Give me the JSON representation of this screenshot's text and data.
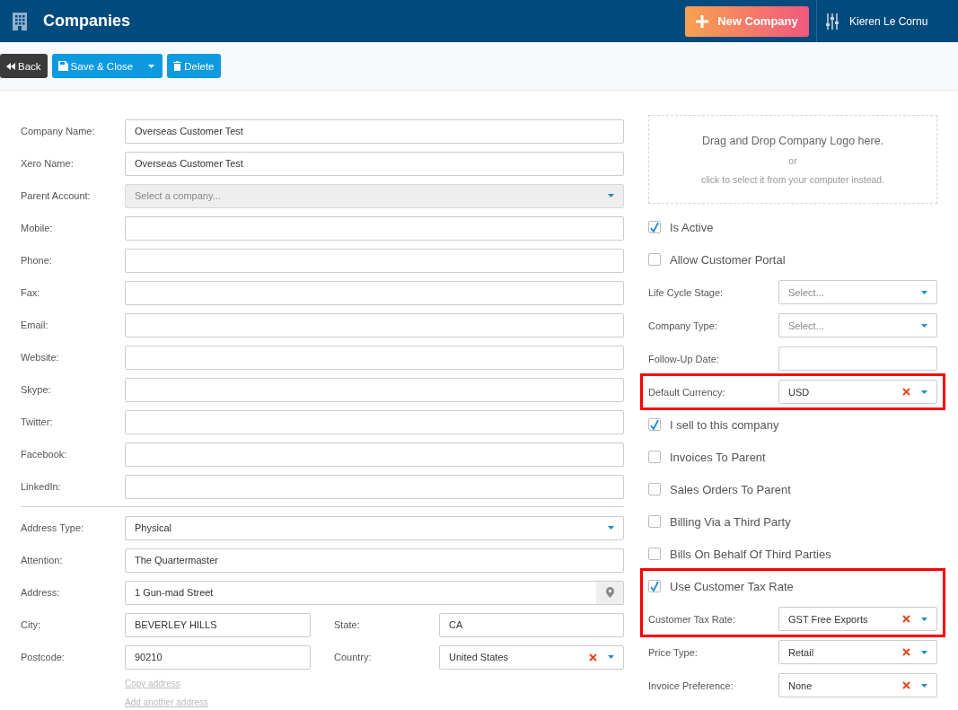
{
  "header": {
    "title": "Companies",
    "new_button": "New Company",
    "user": "Kieren Le Cornu"
  },
  "toolbar": {
    "back": "Back",
    "save": "Save & Close",
    "delete": "Delete"
  },
  "left_fields": [
    {
      "kind": "text",
      "label": "Company Name:",
      "value": "Overseas Customer Test"
    },
    {
      "kind": "text",
      "label": "Xero Name:",
      "value": "Overseas Customer Test"
    },
    {
      "kind": "select",
      "label": "Parent Account:",
      "placeholder": "Select a company...",
      "disabled": true,
      "clearable": false
    },
    {
      "kind": "text",
      "label": "Mobile:"
    },
    {
      "kind": "text",
      "label": "Phone:"
    },
    {
      "kind": "text",
      "label": "Fax:"
    },
    {
      "kind": "text",
      "label": "Email:"
    },
    {
      "kind": "text",
      "label": "Website:"
    },
    {
      "kind": "text",
      "label": "Skype:"
    },
    {
      "kind": "text",
      "label": "Twitter:"
    },
    {
      "kind": "text",
      "label": "Facebook:"
    },
    {
      "kind": "text",
      "label": "LinkedIn:"
    }
  ],
  "address_fields": [
    {
      "kind": "select",
      "label": "Address Type:",
      "value": "Physical",
      "disabled": false,
      "clearable": false
    },
    {
      "kind": "text",
      "label": "Attention:",
      "value": "The Quartermaster"
    },
    {
      "kind": "address",
      "label": "Address:",
      "value": "1 Gun-mad Street"
    }
  ],
  "address_pairs": [
    [
      {
        "kind": "text",
        "label": "City:",
        "value": "BEVERLEY HILLS"
      },
      {
        "kind": "text",
        "label": "State:",
        "value": "CA"
      }
    ],
    [
      {
        "kind": "text",
        "label": "Postcode:",
        "value": "90210"
      },
      {
        "kind": "select",
        "label": "Country:",
        "value": "United States",
        "disabled": false,
        "clearable": true
      }
    ]
  ],
  "address_links": [
    "Copy address",
    "Add another address"
  ],
  "dropzone": {
    "title": "Drag and Drop Company Logo here.",
    "or": "or",
    "hint": "click to select it from your computer instead."
  },
  "right_groups": [
    {
      "highlighted": false,
      "items": [
        {
          "kind": "checkbox",
          "label": "Is Active",
          "checked": true
        },
        {
          "kind": "checkbox",
          "label": "Allow Customer Portal",
          "checked": false
        },
        {
          "kind": "select",
          "label": "Life Cycle Stage:",
          "placeholder": "Select...",
          "clearable": false
        },
        {
          "kind": "select",
          "label": "Company Type:",
          "placeholder": "Select...",
          "clearable": false
        },
        {
          "kind": "date",
          "label": "Follow-Up Date:"
        }
      ]
    },
    {
      "highlighted": true,
      "items": [
        {
          "kind": "select",
          "label": "Default Currency:",
          "value": "USD",
          "clearable": true
        }
      ]
    },
    {
      "highlighted": false,
      "items": [
        {
          "kind": "checkbox",
          "label": "I sell to this company",
          "checked": true
        },
        {
          "kind": "checkbox",
          "label": "Invoices To Parent",
          "checked": false
        },
        {
          "kind": "checkbox",
          "label": "Sales Orders To Parent",
          "checked": false
        },
        {
          "kind": "checkbox",
          "label": "Billing Via a Third Party",
          "checked": false
        },
        {
          "kind": "checkbox",
          "label": "Bills On Behalf Of Third Parties",
          "checked": false
        }
      ]
    },
    {
      "highlighted": true,
      "items": [
        {
          "kind": "checkbox",
          "label": "Use Customer Tax Rate",
          "checked": true
        },
        {
          "kind": "select",
          "label": "Customer Tax Rate:",
          "value": "GST Free Exports",
          "clearable": true
        }
      ]
    },
    {
      "highlighted": false,
      "items": [
        {
          "kind": "select",
          "label": "Price Type:",
          "value": "Retail",
          "clearable": true
        },
        {
          "kind": "select",
          "label": "Invoice Preference:",
          "value": "None",
          "clearable": true
        }
      ]
    }
  ]
}
